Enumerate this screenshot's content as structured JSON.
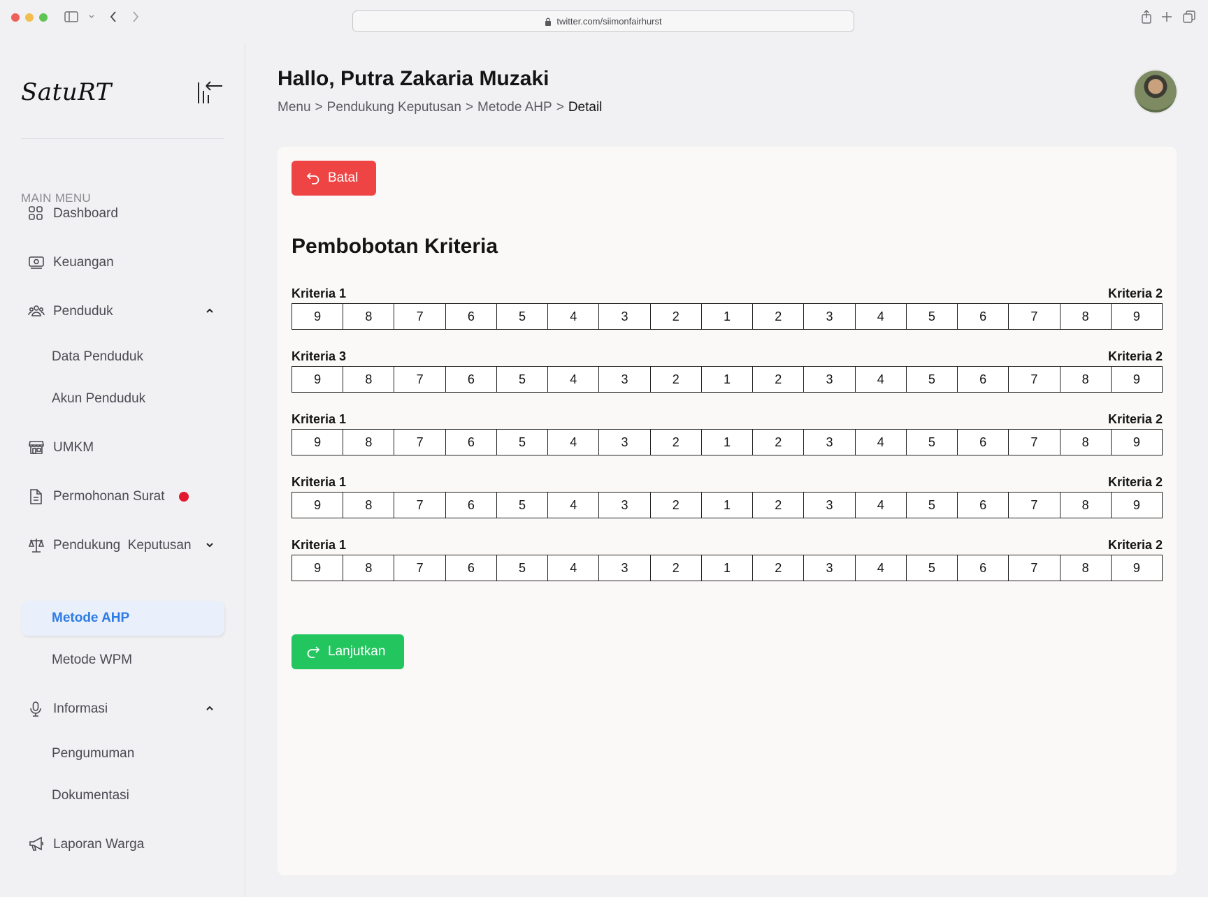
{
  "browser": {
    "url": "twitter.com/siimonfairhurst"
  },
  "sidebar": {
    "logo": "SatuRT",
    "menu_heading": "MAIN MENU",
    "items": [
      {
        "label": "Dashboard",
        "icon": "grid-icon"
      },
      {
        "label": "Keuangan",
        "icon": "money-icon"
      },
      {
        "label": "Penduduk",
        "icon": "users-icon",
        "expanded": true
      },
      {
        "label": "Data Penduduk"
      },
      {
        "label": "Akun Penduduk"
      },
      {
        "label": "UMKM",
        "icon": "store-icon"
      },
      {
        "label": "Permohonan Surat",
        "icon": "document-icon",
        "notification": true
      },
      {
        "label": "Pendukung  Keputusan",
        "icon": "scale-icon",
        "expanded": false
      },
      {
        "label": "Metode AHP",
        "active": true
      },
      {
        "label": "Metode WPM"
      },
      {
        "label": "Informasi",
        "icon": "microphone-icon",
        "expanded": true
      },
      {
        "label": "Pengumuman"
      },
      {
        "label": "Dokumentasi"
      },
      {
        "label": "Laporan Warga",
        "icon": "megaphone-icon"
      }
    ]
  },
  "header": {
    "greeting": "Hallo, Putra Zakaria Muzaki",
    "breadcrumb": [
      "Menu",
      ">",
      "Pendukung Keputusan",
      ">",
      "Metode AHP",
      ">",
      "Detail"
    ]
  },
  "card": {
    "cancel_label": "Batal",
    "continue_label": "Lanjutkan",
    "title": "Pembobotan Kriteria",
    "scale": [
      "9",
      "8",
      "7",
      "6",
      "5",
      "4",
      "3",
      "2",
      "1",
      "2",
      "3",
      "4",
      "5",
      "6",
      "7",
      "8",
      "9"
    ],
    "comparisons": [
      {
        "left": "Kriteria 1",
        "right": "Kriteria 2"
      },
      {
        "left": "Kriteria 3",
        "right": "Kriteria 2"
      },
      {
        "left": "Kriteria 1",
        "right": "Kriteria 2"
      },
      {
        "left": "Kriteria 1",
        "right": "Kriteria 2"
      },
      {
        "left": "Kriteria 1",
        "right": "Kriteria 2"
      }
    ]
  },
  "colors": {
    "danger": "#ef4444",
    "success": "#22c55e",
    "accent": "#2f7be5",
    "notification": "#e3192e"
  }
}
